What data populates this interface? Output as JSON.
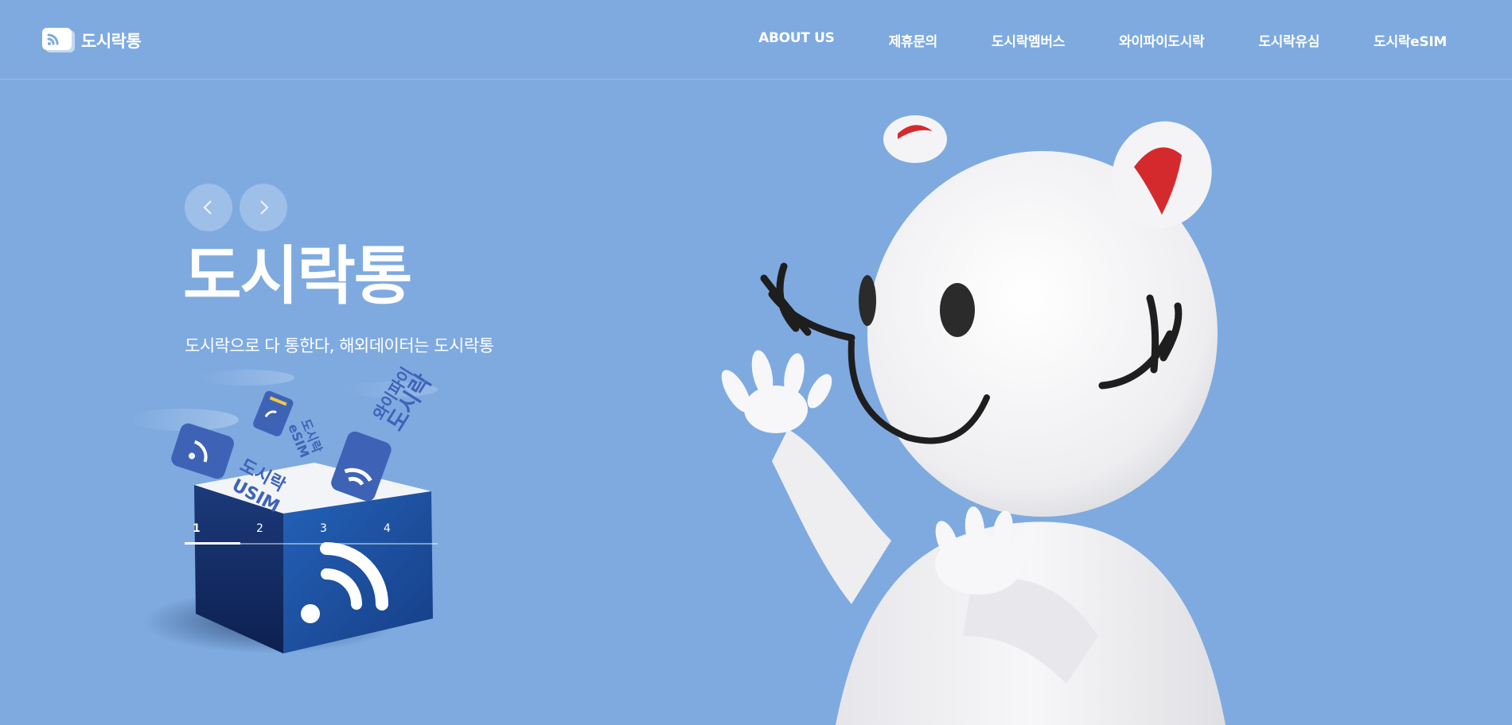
{
  "brand": {
    "name": "도시락통",
    "logo_icon": "wifi-card-icon"
  },
  "nav": {
    "items": [
      {
        "label": "ABOUT US"
      },
      {
        "label": "제휴문의"
      },
      {
        "label": "도시락멤버스"
      },
      {
        "label": "와이파이도시락"
      },
      {
        "label": "도시락유심"
      },
      {
        "label": "도시락eSIM"
      }
    ]
  },
  "hero": {
    "title": "도시락통",
    "subtitle": "도시락으로 다 통한다, 해외데이터는 도시락통",
    "prev_icon": "chevron-left-icon",
    "next_icon": "chevron-right-icon"
  },
  "box_art": {
    "usim_label": [
      "도시락",
      "USIM"
    ],
    "esim_label": [
      "도시락",
      "eSIM"
    ],
    "wifi_label": [
      "와이파이",
      "도시락"
    ]
  },
  "slider": {
    "pages": [
      "1",
      "2",
      "3",
      "4"
    ],
    "active": "1"
  },
  "colors": {
    "background": "#7eaae0",
    "box_dark": "#16316a",
    "box_mid": "#1f57a8",
    "card_blue": "#3e63b6",
    "mascot_white": "#f4f4f6",
    "ear_red": "#d42a2e"
  }
}
